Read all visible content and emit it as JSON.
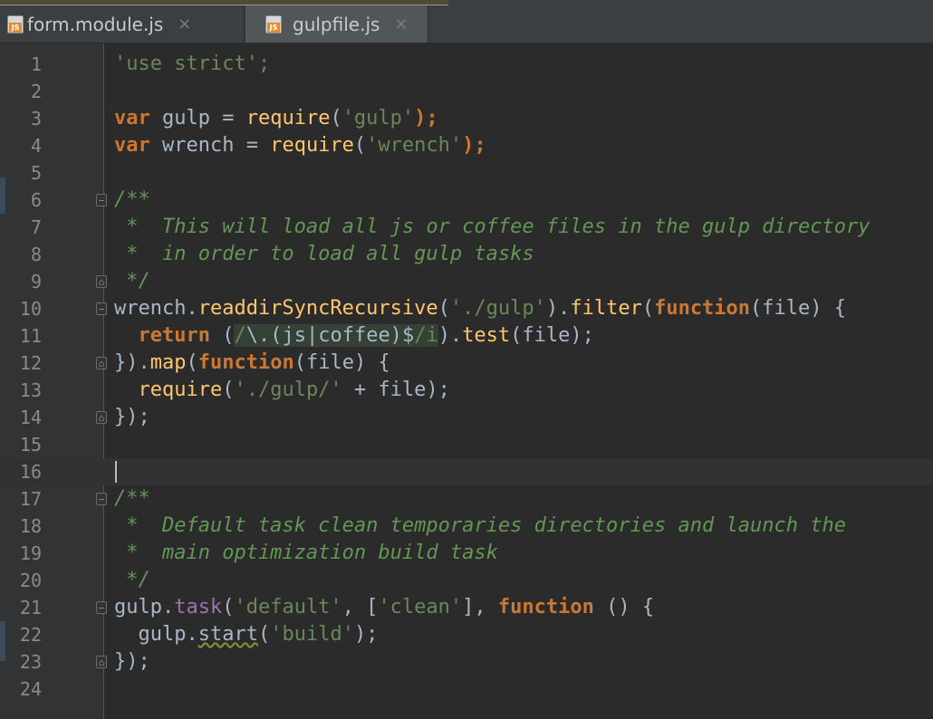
{
  "tabs": [
    {
      "label": "form.module.js",
      "icon": "js-file-icon",
      "active": false
    },
    {
      "label": "gulpfile.js",
      "icon": "js-file-icon",
      "active": true
    }
  ],
  "tab_close_glyph": "×",
  "js_badge": "JS",
  "line_numbers": [
    "1",
    "2",
    "3",
    "4",
    "5",
    "6",
    "7",
    "8",
    "9",
    "10",
    "11",
    "12",
    "13",
    "14",
    "15",
    "16",
    "17",
    "18",
    "19",
    "20",
    "21",
    "22",
    "23",
    "24"
  ],
  "code": {
    "l1": "'use strict';",
    "l3_kw": "var",
    "l3_name": " gulp = ",
    "l3_fn": "require",
    "l3_open": "(",
    "l3_str": "'gulp'",
    "l3_close": ");",
    "l4_kw": "var",
    "l4_name": " wrench = ",
    "l4_fn": "require",
    "l4_open": "(",
    "l4_str": "'wrench'",
    "l4_close": ");",
    "l6": "/**",
    "l7": " *  This will load all js or coffee files in the gulp directory",
    "l8": " *  in order to load all gulp tasks",
    "l9": " */",
    "l10_a": "wrench.",
    "l10_fn": "readdirSyncRecursive",
    "l10_b": "(",
    "l10_str": "'./gulp'",
    "l10_c": ").",
    "l10_fn2": "filter",
    "l10_d": "(",
    "l10_kw": "function",
    "l10_e": "(file) {",
    "l11_kw": "return",
    "l11_a": " (",
    "l11_rx1": "/",
    "l11_rx2": "\\.",
    "l11_rx3": "(js|coffee)",
    "l11_rx4": "$",
    "l11_rx5": "/i",
    "l11_b": ").",
    "l11_fn": "test",
    "l11_c": "(file);",
    "l12_a": "}).",
    "l12_fn": "map",
    "l12_b": "(",
    "l12_kw": "function",
    "l12_c": "(file) {",
    "l13_fn": "require",
    "l13_a": "(",
    "l13_str": "'./gulp/'",
    "l13_b": " + file);",
    "l14": "});",
    "l17": "/**",
    "l18": " *  Default task clean temporaries directories and launch the",
    "l19": " *  main optimization build task",
    "l20": " */",
    "l21_a": "gulp.",
    "l21_mem": "task",
    "l21_b": "(",
    "l21_str1": "'default'",
    "l21_c": ", [",
    "l21_str2": "'clean'",
    "l21_d": "], ",
    "l21_kw": "function",
    "l21_e": " () {",
    "l22_a": "gulp.",
    "l22_typo": "start",
    "l22_b": "(",
    "l22_str": "'build'",
    "l22_c": ");",
    "l23": "});"
  },
  "colors": {
    "background": "#2b2b2b",
    "keyword": "#cc7832",
    "string": "#6a8759",
    "comment": "#629755",
    "function": "#ffc66d",
    "member": "#9876aa",
    "text": "#a9b7c6"
  }
}
